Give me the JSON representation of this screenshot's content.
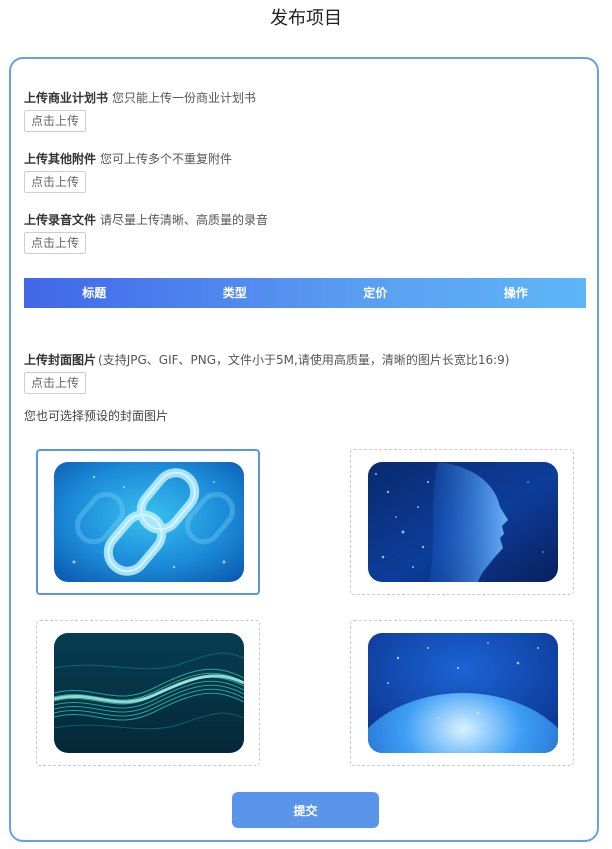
{
  "page": {
    "title": "发布项目"
  },
  "uploads": {
    "plan": {
      "title": "上传商业计划书",
      "hint": "您只能上传一份商业计划书",
      "button": "点击上传"
    },
    "attachments": {
      "title": "上传其他附件",
      "hint": "您可上传多个不重复附件",
      "button": "点击上传"
    },
    "audio": {
      "title": "上传录音文件",
      "hint": "请尽量上传清晰、高质量的录音",
      "button": "点击上传"
    },
    "cover": {
      "title": "上传封面图片",
      "hint": "(支持JPG、GIF、PNG，文件小于5M,请使用高质量，清晰的图片长宽比16:9)",
      "button": "点击上传"
    }
  },
  "table": {
    "columns": [
      "标题",
      "类型",
      "定价",
      "操作"
    ]
  },
  "presets": {
    "label": "您也可选择预设的封面图片",
    "items": [
      {
        "name": "chain-link-image",
        "selected": true
      },
      {
        "name": "digital-face-image",
        "selected": false
      },
      {
        "name": "teal-wave-image",
        "selected": false
      },
      {
        "name": "blue-earth-image",
        "selected": false
      }
    ]
  },
  "submit": {
    "label": "提交"
  },
  "colors": {
    "accent": "#5b95ea",
    "card_border": "#6a9fe6",
    "header_start": "#4166e8",
    "header_end": "#5eb6f6"
  }
}
